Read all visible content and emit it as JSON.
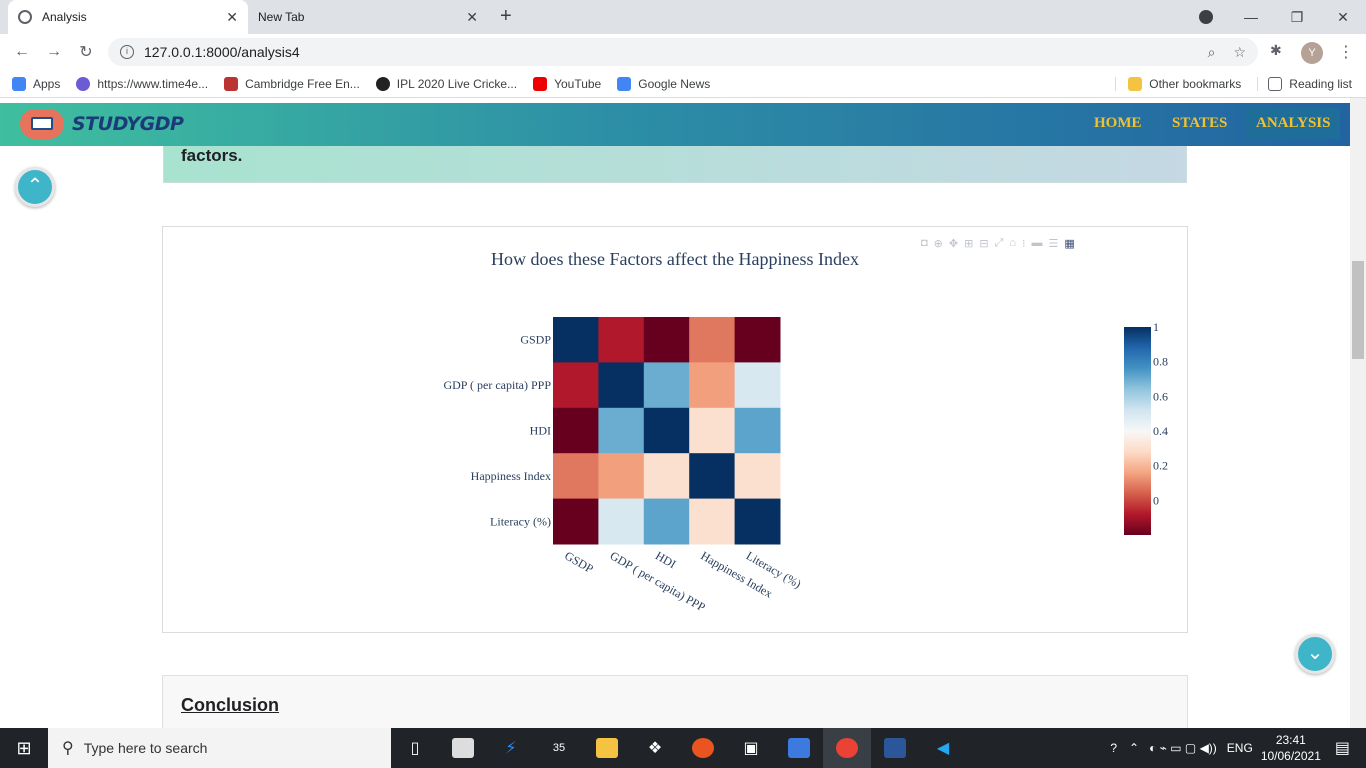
{
  "browser": {
    "tabs": [
      {
        "title": "Analysis"
      },
      {
        "title": "New Tab"
      }
    ],
    "new_tab_symbol": "+",
    "url": "127.0.0.1:8000/analysis4",
    "bookmarks": [
      {
        "label": "Apps",
        "color": "#4285f4"
      },
      {
        "label": "https://www.time4e...",
        "color": "#6b5bd4"
      },
      {
        "label": "Cambridge Free En...",
        "color": "#b33"
      },
      {
        "label": "IPL 2020 Live Cricke...",
        "color": "#222"
      },
      {
        "label": "YouTube",
        "color": "#e00"
      },
      {
        "label": "Google News",
        "color": "#4285f4"
      }
    ],
    "other_bookmarks": "Other bookmarks",
    "reading_list": "Reading list",
    "avatar_letter": "Y"
  },
  "site": {
    "logo": "STUDYGDP",
    "nav": {
      "home": "HOME",
      "states": "STATES",
      "analysis": "ANALYSIS"
    },
    "banner_text": "factors.",
    "conclusion": "Conclusion"
  },
  "chart_data": {
    "type": "heatmap",
    "title": "How does these Factors affect the Happiness Index",
    "x": [
      "GSDP",
      "GDP ( per capita) PPP",
      "HDI",
      "Happiness Index",
      "Literacy (%)"
    ],
    "y": [
      "GSDP",
      "GDP ( per capita) PPP",
      "HDI",
      "Happiness Index",
      "Literacy (%)"
    ],
    "z": [
      [
        1,
        -0.08,
        -0.2,
        0.08,
        -0.2
      ],
      [
        -0.08,
        1,
        0.7,
        0.15,
        0.5
      ],
      [
        -0.2,
        0.7,
        1,
        0.3,
        0.72
      ],
      [
        0.08,
        0.15,
        0.3,
        1,
        0.3
      ],
      [
        -0.2,
        0.5,
        0.72,
        0.3,
        1
      ]
    ],
    "colorscale": "RdBu",
    "colorbar_ticks": [
      "1",
      "0.8",
      "0.6",
      "0.4",
      "0.2",
      "0"
    ],
    "zmin": -0.2,
    "zmax": 1
  },
  "taskbar": {
    "search_placeholder": "Type here to search",
    "mail_badge": "35",
    "lang": "ENG",
    "time": "23:41",
    "date": "10/06/2021"
  }
}
